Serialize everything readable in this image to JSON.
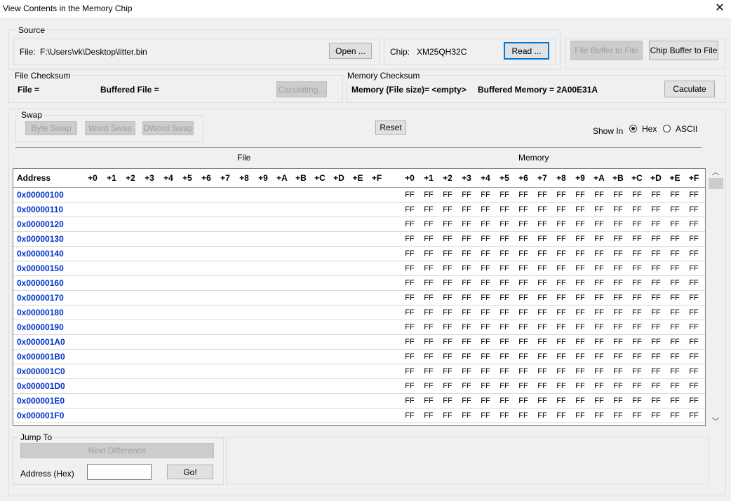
{
  "window": {
    "title": "View Contents in the Memory Chip",
    "close_glyph": "✕"
  },
  "source": {
    "label": "Source",
    "file_label": "File:",
    "file_path": "F:\\Users\\vk\\Desktop\\litter.bin",
    "open_button": "Open ...",
    "chip_label": "Chip:",
    "chip_name": "XM25QH32C",
    "read_button": "Read ...",
    "file_buffer_to_file": "File Buffer to File",
    "chip_buffer_to_file": "Chip Buffer to File"
  },
  "file_checksum": {
    "label": "File Checksum",
    "file": "File =",
    "buffered_file": "Buffered File =",
    "calc_button": "Caculating..."
  },
  "memory_checksum": {
    "label": "Memory Checksum",
    "memory_text": "Memory (File size)= <empty>",
    "buffered_text": "Buffered Memory = 2A00E31A",
    "calc_button": "Caculate"
  },
  "swap": {
    "label": "Swap",
    "byte_swap": "Byte Swap",
    "word_swap": "Word Swap",
    "dword_swap": "DWord Swap",
    "reset": "Reset",
    "show_in": "Show In",
    "hex": "Hex",
    "ascii": "ASCII",
    "selected": "Hex"
  },
  "grid": {
    "file_section": "File",
    "memory_section": "Memory",
    "address_header": "Address",
    "offsets": [
      "+0",
      "+1",
      "+2",
      "+3",
      "+4",
      "+5",
      "+6",
      "+7",
      "+8",
      "+9",
      "+A",
      "+B",
      "+C",
      "+D",
      "+E",
      "+F"
    ],
    "rows": [
      {
        "address": "0x00000100",
        "memory": [
          "FF",
          "FF",
          "FF",
          "FF",
          "FF",
          "FF",
          "FF",
          "FF",
          "FF",
          "FF",
          "FF",
          "FF",
          "FF",
          "FF",
          "FF",
          "FF"
        ]
      },
      {
        "address": "0x00000110",
        "memory": [
          "FF",
          "FF",
          "FF",
          "FF",
          "FF",
          "FF",
          "FF",
          "FF",
          "FF",
          "FF",
          "FF",
          "FF",
          "FF",
          "FF",
          "FF",
          "FF"
        ]
      },
      {
        "address": "0x00000120",
        "memory": [
          "FF",
          "FF",
          "FF",
          "FF",
          "FF",
          "FF",
          "FF",
          "FF",
          "FF",
          "FF",
          "FF",
          "FF",
          "FF",
          "FF",
          "FF",
          "FF"
        ]
      },
      {
        "address": "0x00000130",
        "memory": [
          "FF",
          "FF",
          "FF",
          "FF",
          "FF",
          "FF",
          "FF",
          "FF",
          "FF",
          "FF",
          "FF",
          "FF",
          "FF",
          "FF",
          "FF",
          "FF"
        ]
      },
      {
        "address": "0x00000140",
        "memory": [
          "FF",
          "FF",
          "FF",
          "FF",
          "FF",
          "FF",
          "FF",
          "FF",
          "FF",
          "FF",
          "FF",
          "FF",
          "FF",
          "FF",
          "FF",
          "FF"
        ]
      },
      {
        "address": "0x00000150",
        "memory": [
          "FF",
          "FF",
          "FF",
          "FF",
          "FF",
          "FF",
          "FF",
          "FF",
          "FF",
          "FF",
          "FF",
          "FF",
          "FF",
          "FF",
          "FF",
          "FF"
        ]
      },
      {
        "address": "0x00000160",
        "memory": [
          "FF",
          "FF",
          "FF",
          "FF",
          "FF",
          "FF",
          "FF",
          "FF",
          "FF",
          "FF",
          "FF",
          "FF",
          "FF",
          "FF",
          "FF",
          "FF"
        ]
      },
      {
        "address": "0x00000170",
        "memory": [
          "FF",
          "FF",
          "FF",
          "FF",
          "FF",
          "FF",
          "FF",
          "FF",
          "FF",
          "FF",
          "FF",
          "FF",
          "FF",
          "FF",
          "FF",
          "FF"
        ]
      },
      {
        "address": "0x00000180",
        "memory": [
          "FF",
          "FF",
          "FF",
          "FF",
          "FF",
          "FF",
          "FF",
          "FF",
          "FF",
          "FF",
          "FF",
          "FF",
          "FF",
          "FF",
          "FF",
          "FF"
        ]
      },
      {
        "address": "0x00000190",
        "memory": [
          "FF",
          "FF",
          "FF",
          "FF",
          "FF",
          "FF",
          "FF",
          "FF",
          "FF",
          "FF",
          "FF",
          "FF",
          "FF",
          "FF",
          "FF",
          "FF"
        ]
      },
      {
        "address": "0x000001A0",
        "memory": [
          "FF",
          "FF",
          "FF",
          "FF",
          "FF",
          "FF",
          "FF",
          "FF",
          "FF",
          "FF",
          "FF",
          "FF",
          "FF",
          "FF",
          "FF",
          "FF"
        ]
      },
      {
        "address": "0x000001B0",
        "memory": [
          "FF",
          "FF",
          "FF",
          "FF",
          "FF",
          "FF",
          "FF",
          "FF",
          "FF",
          "FF",
          "FF",
          "FF",
          "FF",
          "FF",
          "FF",
          "FF"
        ]
      },
      {
        "address": "0x000001C0",
        "memory": [
          "FF",
          "FF",
          "FF",
          "FF",
          "FF",
          "FF",
          "FF",
          "FF",
          "FF",
          "FF",
          "FF",
          "FF",
          "FF",
          "FF",
          "FF",
          "FF"
        ]
      },
      {
        "address": "0x000001D0",
        "memory": [
          "FF",
          "FF",
          "FF",
          "FF",
          "FF",
          "FF",
          "FF",
          "FF",
          "FF",
          "FF",
          "FF",
          "FF",
          "FF",
          "FF",
          "FF",
          "FF"
        ]
      },
      {
        "address": "0x000001E0",
        "memory": [
          "FF",
          "FF",
          "FF",
          "FF",
          "FF",
          "FF",
          "FF",
          "FF",
          "FF",
          "FF",
          "FF",
          "FF",
          "FF",
          "FF",
          "FF",
          "FF"
        ]
      },
      {
        "address": "0x000001F0",
        "memory": [
          "FF",
          "FF",
          "FF",
          "FF",
          "FF",
          "FF",
          "FF",
          "FF",
          "FF",
          "FF",
          "FF",
          "FF",
          "FF",
          "FF",
          "FF",
          "FF"
        ]
      }
    ]
  },
  "jump": {
    "label": "Jump To",
    "next_difference": "Next Difference",
    "address_label": "Address (Hex)",
    "address_value": "",
    "go": "Go!"
  },
  "colors": {
    "address_text": "#0033cc",
    "focus_border": "#0078d7"
  }
}
